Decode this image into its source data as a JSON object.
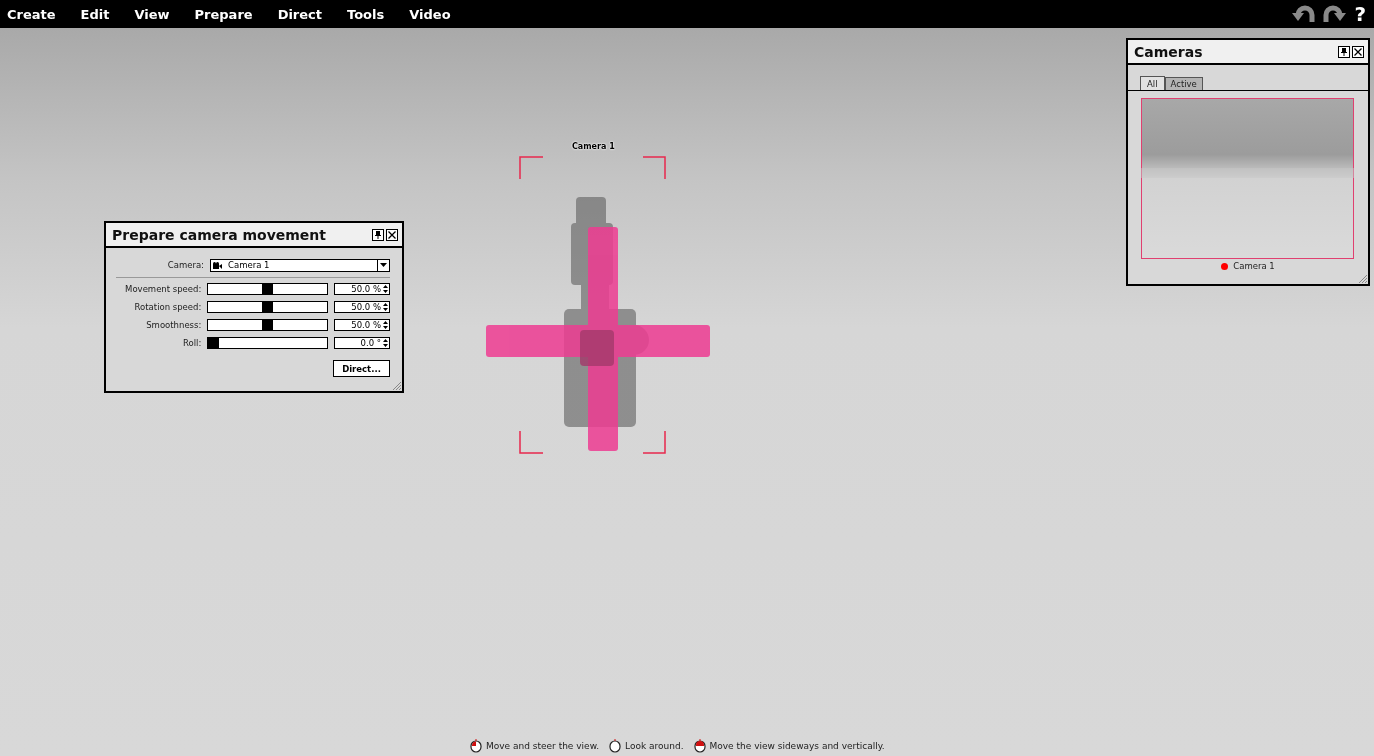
{
  "menu": [
    "Create",
    "Edit",
    "View",
    "Prepare",
    "Direct",
    "Tools",
    "Video"
  ],
  "toolbar": {
    "help": "?"
  },
  "viewport": {
    "camera_label": "Camera 1"
  },
  "prepare_panel": {
    "title": "Prepare camera movement",
    "camera_label": "Camera:",
    "camera_value": "Camera 1",
    "sliders": [
      {
        "label": "Movement speed:",
        "level": 0.5,
        "value": "50.0 %"
      },
      {
        "label": "Rotation speed:",
        "level": 0.5,
        "value": "50.0 %"
      },
      {
        "label": "Smoothness:",
        "level": 0.5,
        "value": "50.0 %"
      },
      {
        "label": "Roll:",
        "level": 0,
        "value": "0.0 °"
      }
    ],
    "button": "Direct..."
  },
  "cameras_panel": {
    "title": "Cameras",
    "tabs": [
      {
        "label": "All",
        "selected": true
      },
      {
        "label": "Active",
        "selected": false
      }
    ],
    "cameras": [
      {
        "name": "Camera 1",
        "color": "#ff0000"
      }
    ]
  },
  "hints": [
    {
      "kind": "left",
      "text": "Move and steer the view."
    },
    {
      "kind": "none",
      "text": "Look around."
    },
    {
      "kind": "middle",
      "text": "Move the view sideways and vertically."
    }
  ]
}
